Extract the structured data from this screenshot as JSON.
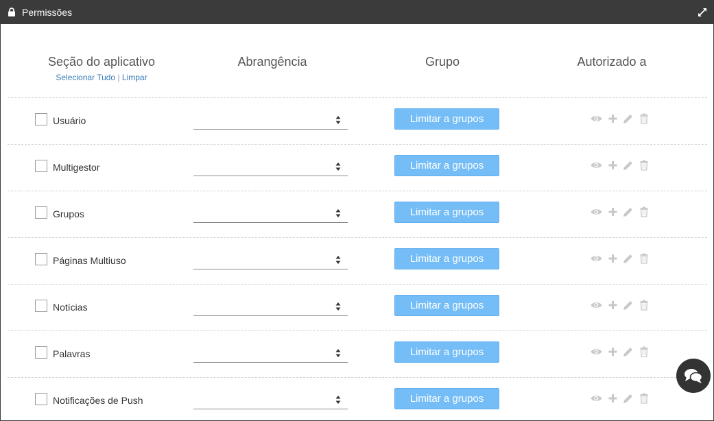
{
  "window": {
    "title": "Permissões",
    "title_icon": "lock-icon",
    "expand_icon": "expand-icon"
  },
  "headers": {
    "section": "Seção do aplicativo",
    "scope": "Abrangência",
    "group": "Grupo",
    "authorized": "Autorizado a"
  },
  "selection": {
    "select_all": "Selecionar Tudo",
    "separator": "|",
    "clear": "Limpar"
  },
  "rows": [
    {
      "label": "Usuário",
      "button": "Limitar a grupos"
    },
    {
      "label": "Multigestor",
      "button": "Limitar a grupos"
    },
    {
      "label": "Grupos",
      "button": "Limitar a grupos"
    },
    {
      "label": "Páginas Multiuso",
      "button": "Limitar a grupos"
    },
    {
      "label": "Notícias",
      "button": "Limitar a grupos"
    },
    {
      "label": "Palavras",
      "button": "Limitar a grupos"
    },
    {
      "label": "Notificações de Push",
      "button": "Limitar a grupos"
    }
  ],
  "permission_icons": [
    "eye-icon",
    "plus-icon",
    "pencil-icon",
    "trash-icon"
  ],
  "chat_icon": "chat-icon",
  "colors": {
    "titlebar": "#3b3b3b",
    "button": "#74bdf6",
    "link": "#337ab7",
    "icon_muted": "#c8c8c8",
    "chat": "#333333"
  }
}
